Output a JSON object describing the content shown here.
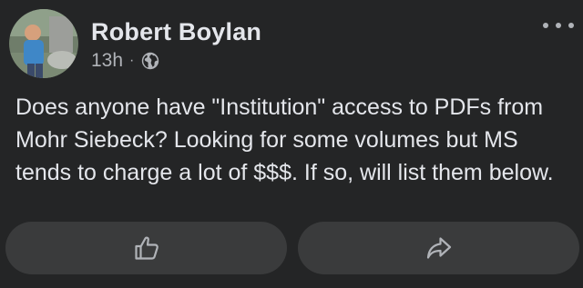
{
  "post": {
    "author": "Robert Boylan",
    "timestamp": "13h",
    "separator": "·",
    "audience_icon": "globe-icon",
    "more_icon": "more-options-icon",
    "text": "Does anyone have \"Institution\" access to PDFs from Mohr Siebeck? Looking for some volumes but MS tends to charge a lot of $$$. If so, will list them below."
  },
  "actions": {
    "like_icon": "thumbs-up-icon",
    "share_icon": "share-arrow-icon"
  },
  "colors": {
    "background": "#242526",
    "button": "#3a3b3c",
    "primary_text": "#e4e6eb",
    "secondary_text": "#b0b3b8"
  }
}
